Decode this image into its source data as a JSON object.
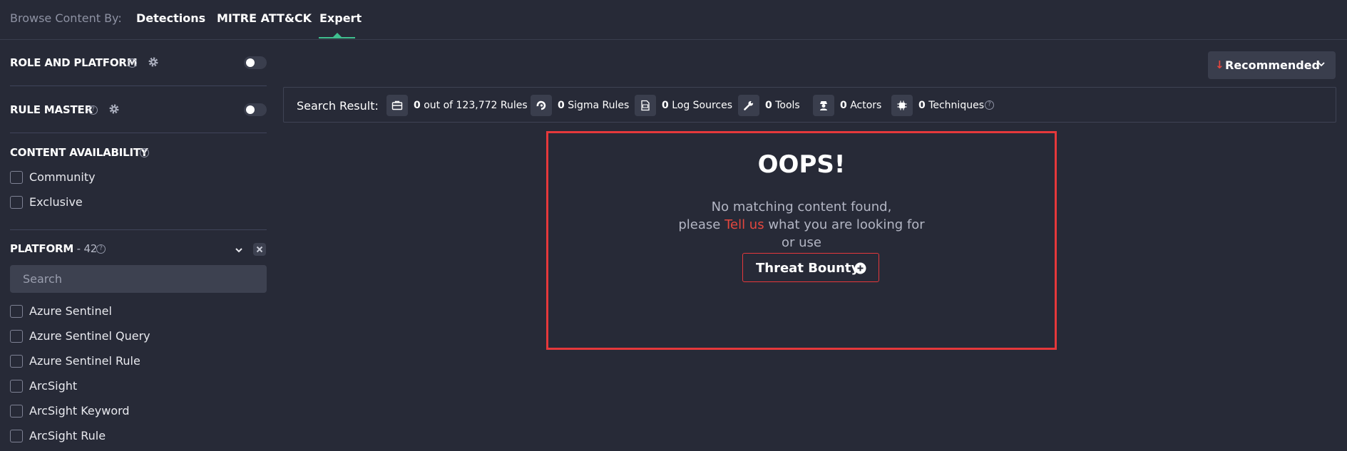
{
  "topnav": {
    "browse_label": "Browse Content By:",
    "tabs": [
      {
        "label": "Detections"
      },
      {
        "label": "MITRE ATT&CK"
      },
      {
        "label": "Expert"
      }
    ],
    "active_tab": "Expert",
    "accent_color": "#3fbf8f"
  },
  "sidebar": {
    "role_platform": {
      "title": "ROLE AND PLATFORM",
      "help": "?",
      "toggle": "off"
    },
    "rule_master": {
      "title": "RULE MASTER",
      "help": "?",
      "toggle": "off"
    },
    "content_availability": {
      "title": "CONTENT AVAILABILITY",
      "help": "?",
      "options": [
        {
          "label": "Community",
          "checked": false
        },
        {
          "label": "Exclusive",
          "checked": false
        }
      ]
    },
    "platform": {
      "title": "PLATFORM",
      "count": " - 42",
      "help": "?",
      "search_placeholder": "Search",
      "options": [
        {
          "label": "Azure Sentinel",
          "checked": false
        },
        {
          "label": "Azure Sentinel Query",
          "checked": false
        },
        {
          "label": "Azure Sentinel Rule",
          "checked": false
        },
        {
          "label": "ArcSight",
          "checked": false
        },
        {
          "label": "ArcSight Keyword",
          "checked": false
        },
        {
          "label": "ArcSight Rule",
          "checked": false
        }
      ]
    }
  },
  "sort": {
    "label": "Recommended",
    "arrow": "↓"
  },
  "results": {
    "label": "Search Result:",
    "stats": [
      {
        "icon": "briefcase-icon",
        "value": "0",
        "text": "out of 123,772 Rules"
      },
      {
        "icon": "sigma-icon",
        "value": "0",
        "text": "Sigma Rules"
      },
      {
        "icon": "log-file-icon",
        "value": "0",
        "text": "Log Sources"
      },
      {
        "icon": "wrench-icon",
        "value": "0",
        "text": "Tools"
      },
      {
        "icon": "spy-icon",
        "value": "0",
        "text": "Actors"
      },
      {
        "icon": "chip-icon",
        "value": "0",
        "text": "Techniques"
      }
    ]
  },
  "empty_state": {
    "title": "OOPS!",
    "line1": "No matching content found,",
    "line2_pre": "please ",
    "line2_link": "Tell us",
    "line2_post": " what you are looking for",
    "line3": "or use",
    "button_label": "Threat Bounty",
    "border_color": "#e5383b"
  }
}
